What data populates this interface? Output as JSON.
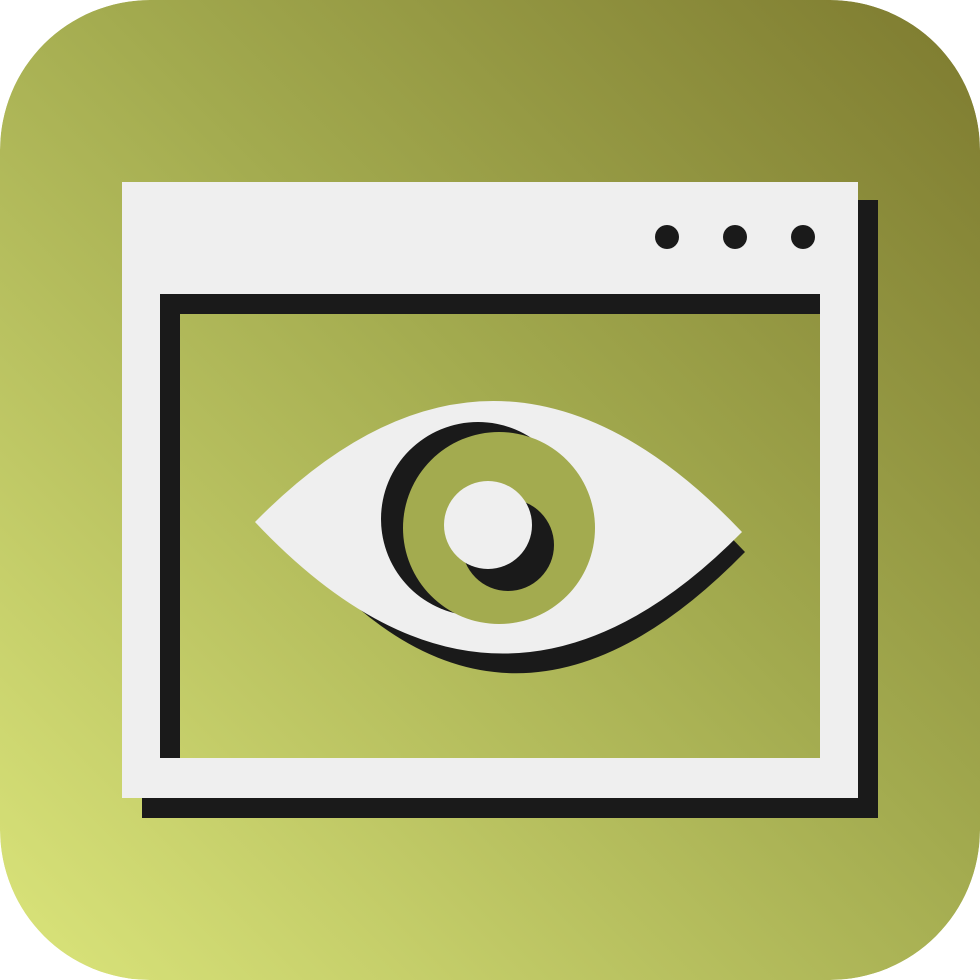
{
  "icon": {
    "name": "browser-window-eye-icon",
    "colors": {
      "gradient_light": "#dbe57b",
      "gradient_mid": "#a3ab4f",
      "gradient_dark": "#7d7a2f",
      "panel": "#efefef",
      "outline": "#1a1a1a"
    }
  }
}
